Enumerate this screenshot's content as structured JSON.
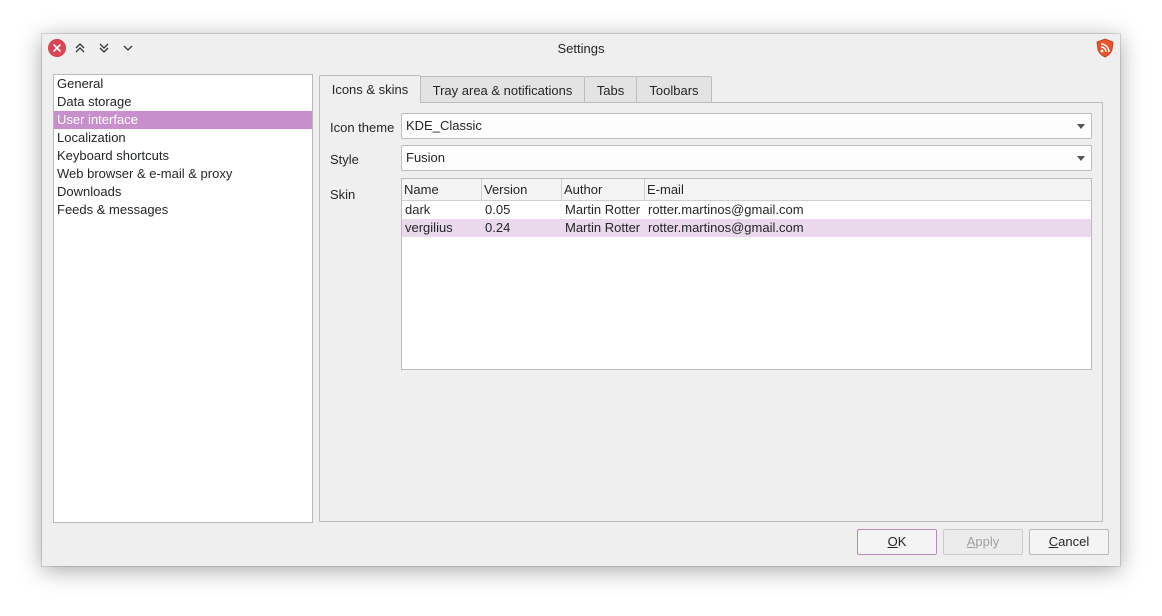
{
  "window": {
    "title": "Settings",
    "close_icon": "close-icon",
    "keep_above_icon": "chevrons-up-icon",
    "keep_below_icon": "chevrons-down-icon",
    "minimize_icon": "chevron-down-icon",
    "app_icon": "rss-shield-icon",
    "close_color": "#da4453"
  },
  "sidebar": {
    "items": [
      {
        "label": "General",
        "selected": false
      },
      {
        "label": "Data storage",
        "selected": false
      },
      {
        "label": "User interface",
        "selected": true
      },
      {
        "label": "Localization",
        "selected": false
      },
      {
        "label": "Keyboard shortcuts",
        "selected": false
      },
      {
        "label": "Web browser & e-mail & proxy",
        "selected": false
      },
      {
        "label": "Downloads",
        "selected": false
      },
      {
        "label": "Feeds & messages",
        "selected": false
      }
    ],
    "selection_color": "#c78fcb"
  },
  "tabs": [
    {
      "label": "Icons & skins",
      "active": true
    },
    {
      "label": "Tray area & notifications",
      "active": false
    },
    {
      "label": "Tabs",
      "active": false
    },
    {
      "label": "Toolbars",
      "active": false
    }
  ],
  "form": {
    "icon_theme_label": "Icon theme",
    "icon_theme_value": "KDE_Classic",
    "style_label": "Style",
    "style_value": "Fusion",
    "skin_label": "Skin"
  },
  "skins_table": {
    "columns": [
      "Name",
      "Version",
      "Author",
      "E-mail"
    ],
    "rows": [
      {
        "name": "dark",
        "version": "0.05",
        "author": "Martin Rotter",
        "email": "rotter.martinos@gmail.com",
        "selected": false
      },
      {
        "name": "vergilius",
        "version": "0.24",
        "author": "Martin Rotter",
        "email": "rotter.martinos@gmail.com",
        "selected": true
      }
    ],
    "selection_color": "#ead8ec"
  },
  "buttons": {
    "ok_mnemonic": "O",
    "ok_rest": "K",
    "apply_mnemonic": "A",
    "apply_rest": "pply",
    "cancel_mnemonic": "C",
    "cancel_rest": "ancel",
    "apply_enabled": false
  }
}
